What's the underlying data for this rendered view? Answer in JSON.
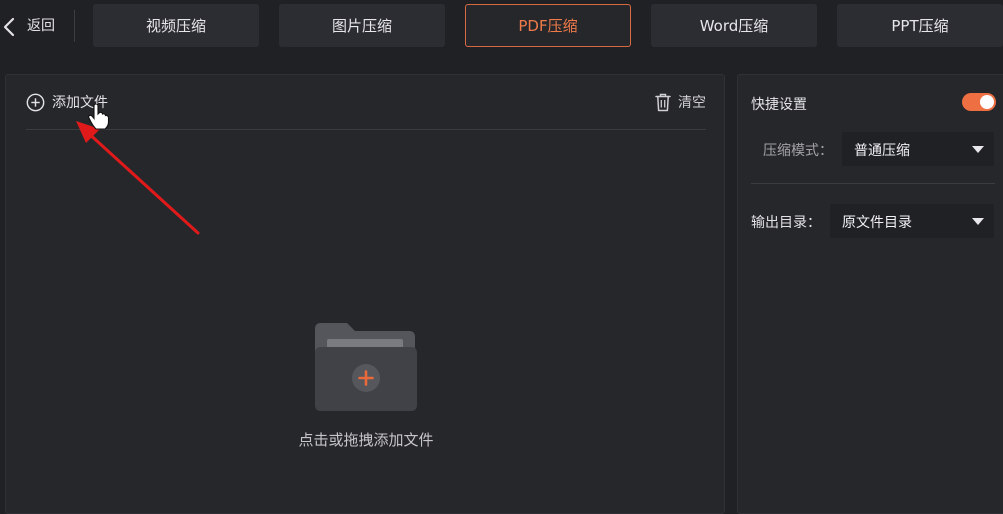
{
  "header": {
    "back_label": "返回",
    "tabs": [
      {
        "label": "视频压缩",
        "active": false
      },
      {
        "label": "图片压缩",
        "active": false
      },
      {
        "label": "PDF压缩",
        "active": true
      },
      {
        "label": "Word压缩",
        "active": false
      },
      {
        "label": "PPT压缩",
        "active": false
      }
    ]
  },
  "file_panel": {
    "add_file_label": "添加文件",
    "clear_label": "清空",
    "drop_hint": "点击或拖拽添加文件"
  },
  "settings": {
    "quick_settings_label": "快捷设置",
    "quick_settings_enabled": true,
    "compress_mode_label": "压缩模式：",
    "compress_mode_value": "普通压缩",
    "output_dir_label": "输出目录：",
    "output_dir_value": "原文件目录"
  },
  "colors": {
    "accent": "#ee7042",
    "background": "#202125",
    "panel": "#26272b",
    "annotation_arrow": "#e01a1a"
  },
  "icons": {
    "back": "chevron-left-icon",
    "add": "plus-circle-icon",
    "clear": "trash-icon",
    "folder": "folder-plus-icon",
    "cursor": "hand-pointer-icon"
  }
}
